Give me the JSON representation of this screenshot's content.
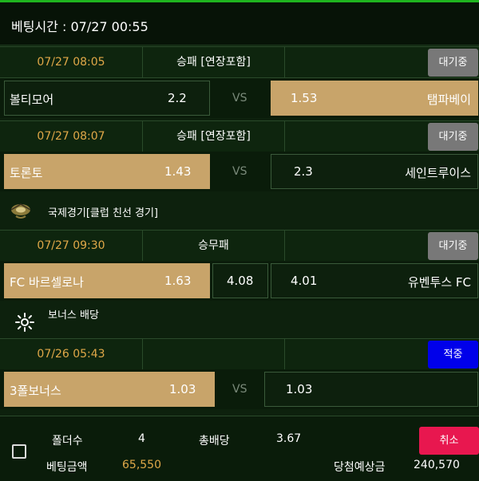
{
  "header": {
    "title": "베팅시간 : 07/27 00:55"
  },
  "games": [
    {
      "time": "07/27 08:05",
      "type": "승패 [연장포함]",
      "status": "대기중",
      "home": {
        "name": "볼티모어",
        "odd": "2.2"
      },
      "vs": "VS",
      "away": {
        "name": "탬파베이",
        "odd": "1.53"
      }
    },
    {
      "time": "07/27 08:07",
      "type": "승패 [연장포함]",
      "status": "대기중",
      "home": {
        "name": "토론토",
        "odd": "1.43"
      },
      "vs": "VS",
      "away": {
        "name": "세인트루이스",
        "odd": "2.3"
      }
    },
    {
      "league": "국제경기[클럽 친선 경기]",
      "time": "07/27 09:30",
      "type": "승무패",
      "status": "대기중",
      "home": {
        "name": "FC 바르셀로나",
        "odd": "1.63"
      },
      "draw": "4.08",
      "away": {
        "name": "유벤투스 FC",
        "odd": "4.01"
      }
    },
    {
      "league": "보너스 배당",
      "time": "07/26 05:43",
      "type": "",
      "status": "적중",
      "home": {
        "name": "3폴보너스",
        "odd": "1.03"
      },
      "vs": "VS",
      "away": {
        "name": "",
        "odd": "1.03"
      }
    }
  ],
  "footer": {
    "folder_label": "폴더수",
    "folder_value": "4",
    "total_odds_label": "총배당",
    "total_odds_value": "3.67",
    "cancel_label": "취소",
    "bet_amount_label": "베팅금액",
    "bet_amount_value": "65,550",
    "expected_label": "당첨예상금",
    "expected_value": "240,570"
  },
  "icons": {
    "league1": "soccer-ball-icon",
    "league2": "bonus-sun-icon",
    "checkbox": "checkbox-icon"
  },
  "colors": {
    "selected": "#c8a46a",
    "time": "#e0a848",
    "wait_badge": "#787878",
    "hit_badge": "#0000ea",
    "cancel": "#e8174f"
  }
}
